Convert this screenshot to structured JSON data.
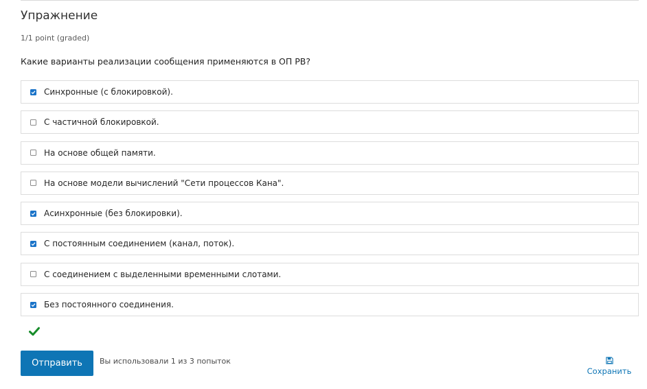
{
  "problem": {
    "title": "Упражнение",
    "points": "1/1 point (graded)",
    "question": "Какие варианты реализации сообщения применяются в ОП РВ?"
  },
  "options": [
    {
      "label": "Синхронные (с блокировкой).",
      "checked": true
    },
    {
      "label": "С частичной блокировкой.",
      "checked": false
    },
    {
      "label": "На основе общей памяти.",
      "checked": false
    },
    {
      "label": "На основе модели вычислений \"Сети процессов Кана\".",
      "checked": false
    },
    {
      "label": "Асинхронные (без блокировки).",
      "checked": true
    },
    {
      "label": "С постоянным соединением (канал, поток).",
      "checked": true
    },
    {
      "label": "С соединением с выделенными временными слотами.",
      "checked": false
    },
    {
      "label": "Без постоянного соединения.",
      "checked": true
    }
  ],
  "result": {
    "status": "correct",
    "icon": "checkmark-icon",
    "color": "#178c2a"
  },
  "actions": {
    "submit_label": "Отправить",
    "attempts_text": "Вы использовали 1 из 3 попыток",
    "save_label": "Сохранить",
    "save_icon": "floppy-disk-icon"
  },
  "colors": {
    "accent": "#0e75b5",
    "checkbox_checked": "#1a73c8"
  }
}
